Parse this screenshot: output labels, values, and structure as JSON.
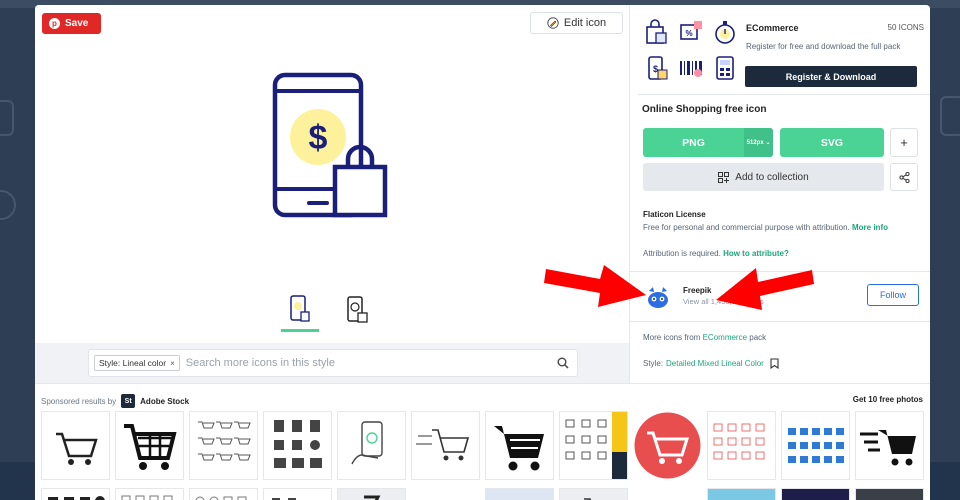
{
  "toolbar": {
    "save_label": "Save",
    "edit_label": "Edit icon"
  },
  "search": {
    "style_chip": "Style: Lineal color",
    "chip_close": "×",
    "placeholder": "Search more icons in this style"
  },
  "pack": {
    "name": "ECommerce",
    "count": "50 ICONS",
    "description": "Register for free and download the full pack",
    "register_label": "Register & Download"
  },
  "icon": {
    "title": "Online Shopping free icon"
  },
  "download": {
    "png_label": "PNG",
    "png_size": "512px ⌄",
    "svg_label": "SVG",
    "plus_label": "+",
    "collection_label": "Add to collection"
  },
  "license": {
    "title": "Flaticon License",
    "description": "Free for personal and commercial purpose with attribution.",
    "more_info": "More info"
  },
  "attribution": {
    "text": "Attribution is required.",
    "link": "How to attribute?"
  },
  "author": {
    "name": "Freepik",
    "subtitle": "View all 1,450,018 icons",
    "follow_label": "Follow"
  },
  "more": {
    "prefix": "More icons from",
    "pack_link": "ECommerce",
    "suffix": "pack"
  },
  "style": {
    "label": "Style:",
    "value": "Detailed Mixed Lineal Color"
  },
  "sponsored": {
    "prefix": "Sponsored results by",
    "brand": "Adobe Stock",
    "logo": "St",
    "get_free": "Get 10 free photos"
  },
  "colors": {
    "accent_green": "#4ad395",
    "save_red": "#e02926",
    "dark_navy": "#1d2a3c",
    "icon_navy": "#1a1f7a",
    "icon_yellow": "#fdf29b",
    "arrow_red": "#ff0000"
  }
}
